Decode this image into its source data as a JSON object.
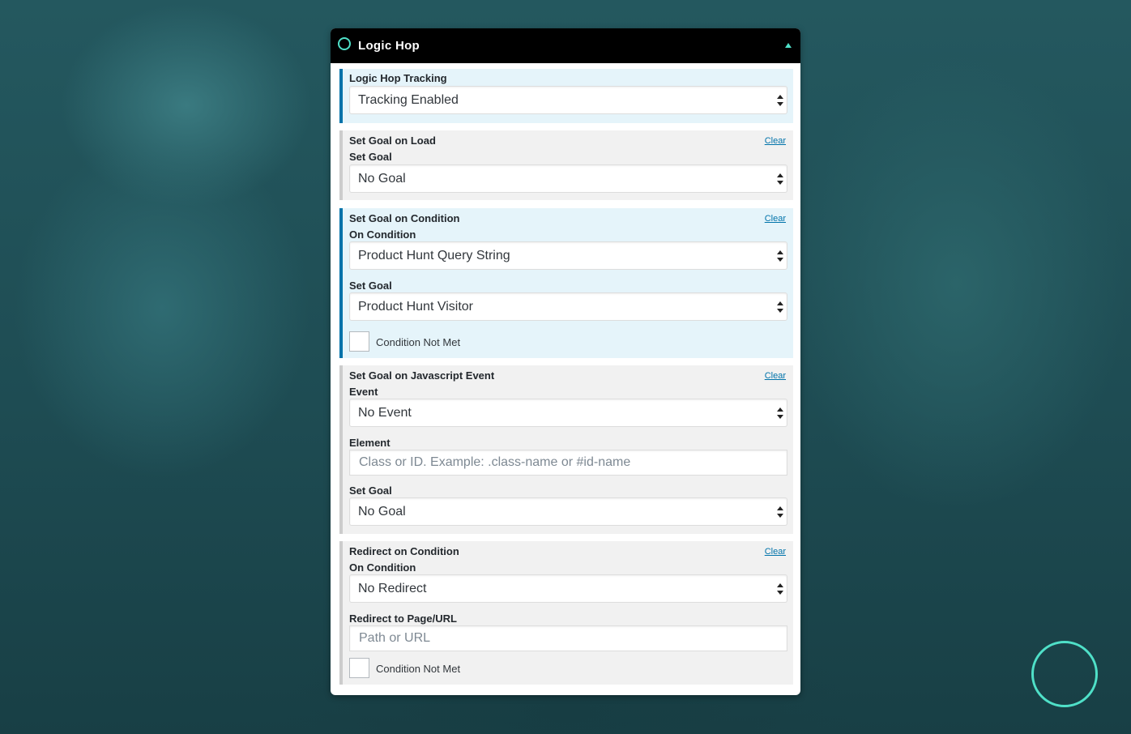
{
  "widget": {
    "title": "Logic Hop",
    "logo_icon": "logic-hop-ring-icon",
    "collapse_icon": "triangle-up-icon",
    "accent_color": "#4fe0c8"
  },
  "tracking": {
    "label": "Logic Hop Tracking",
    "value": "Tracking Enabled"
  },
  "goal_on_load": {
    "title": "Set Goal on Load",
    "clear": "Clear",
    "goal_label": "Set Goal",
    "goal_value": "No Goal"
  },
  "goal_on_condition": {
    "title": "Set Goal on Condition",
    "clear": "Clear",
    "condition_label": "On Condition",
    "condition_value": "Product Hunt Query String",
    "goal_label": "Set Goal",
    "goal_value": "Product Hunt Visitor",
    "not_met_label": "Condition Not Met"
  },
  "goal_on_js_event": {
    "title": "Set Goal on Javascript Event",
    "clear": "Clear",
    "event_label": "Event",
    "event_value": "No Event",
    "element_label": "Element",
    "element_placeholder": "Class or ID. Example: .class-name or #id-name",
    "goal_label": "Set Goal",
    "goal_value": "No Goal"
  },
  "redirect_on_condition": {
    "title": "Redirect on Condition",
    "clear": "Clear",
    "condition_label": "On Condition",
    "condition_value": "No Redirect",
    "redirect_label": "Redirect to Page/URL",
    "redirect_placeholder": "Path or URL",
    "not_met_label": "Condition Not Met"
  }
}
